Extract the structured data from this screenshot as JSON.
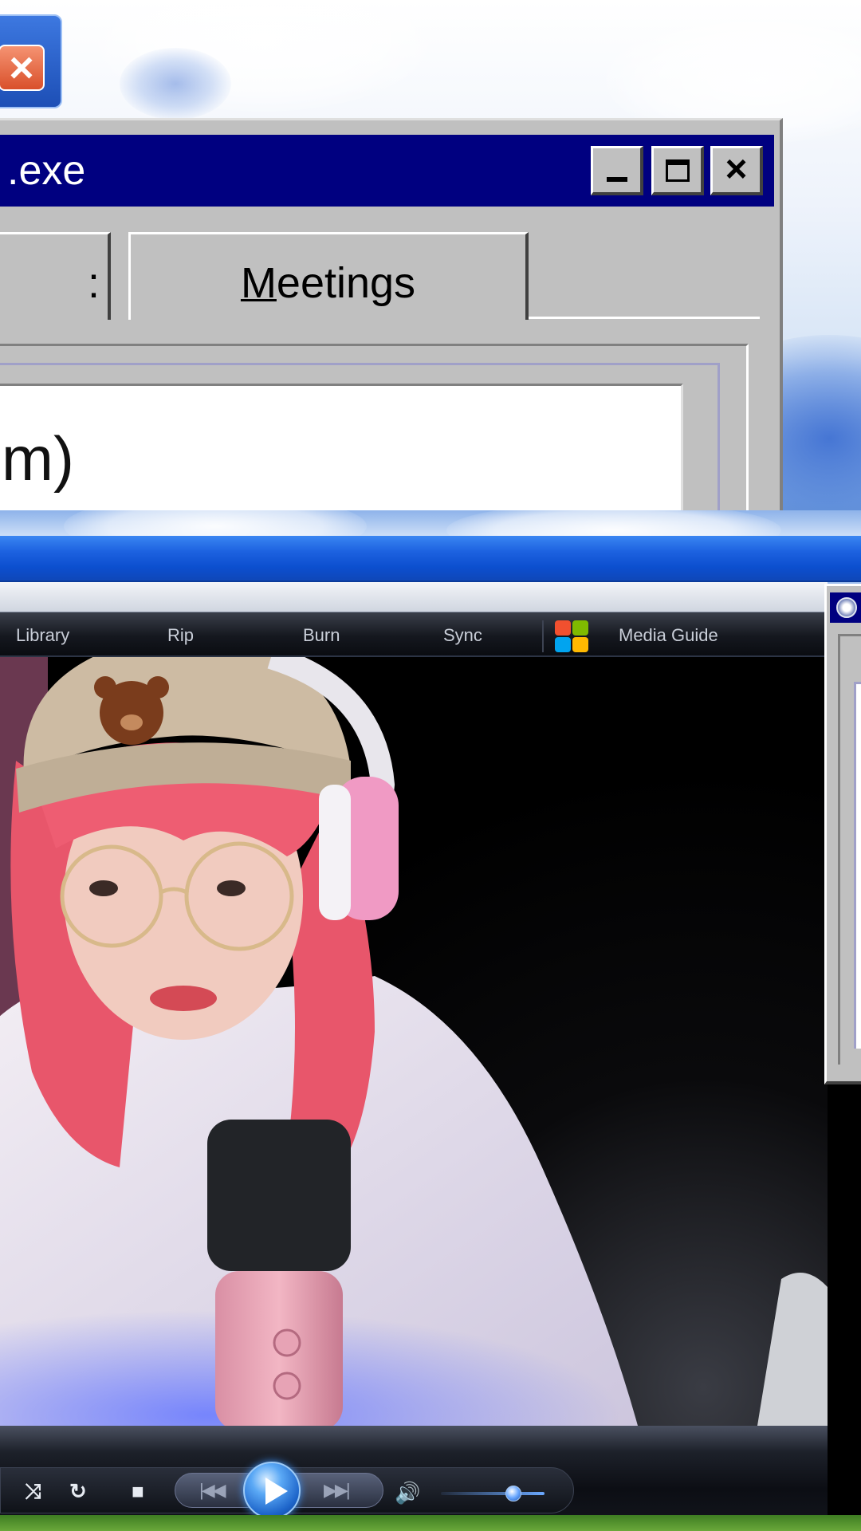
{
  "win98_window": {
    "title": ".exe",
    "tabs": [
      {
        "label": ":"
      },
      {
        "label_accel": "M",
        "label_rest": "eetings"
      }
    ],
    "text_value": "m)",
    "buttons": {
      "minimize": "_",
      "maximize": "□",
      "close": "×"
    }
  },
  "background_close": "×",
  "media_player": {
    "nav_items": [
      {
        "label": "Library"
      },
      {
        "label": "Rip"
      },
      {
        "label": "Burn"
      },
      {
        "label": "Sync"
      },
      {
        "label": "Media Guide"
      }
    ],
    "controls": {
      "shuffle": "⤨",
      "repeat": "↻",
      "stop": "■",
      "previous": "|◀◀",
      "next": "▶▶|",
      "volume": "🔊"
    },
    "volume_level": 0.7
  },
  "colors": {
    "win98_title": "#000080",
    "win98_face": "#c0c0c0",
    "xp_taskbar": "#1d62e0",
    "play_button": "#1d64c9"
  }
}
